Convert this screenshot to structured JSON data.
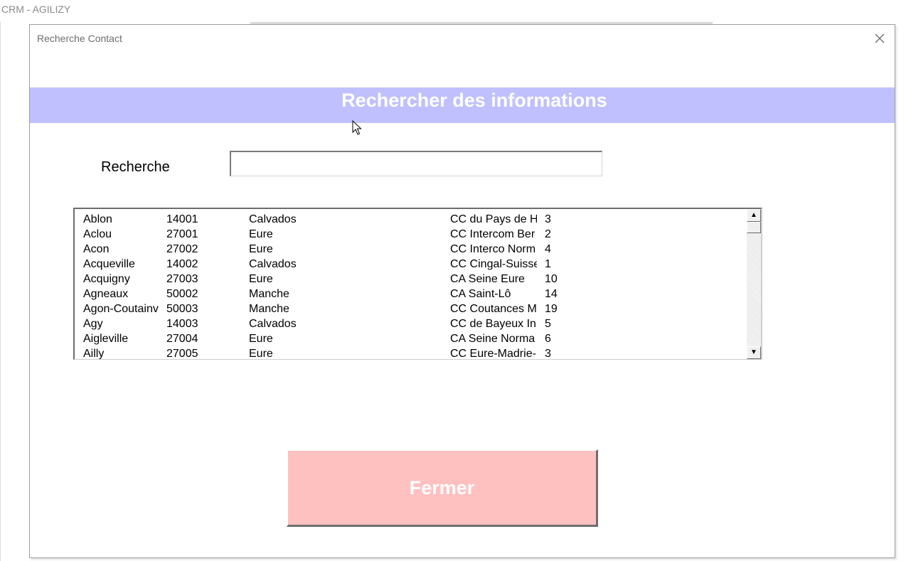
{
  "app": {
    "title": "CRM - AGILIZY"
  },
  "dialog": {
    "title": "Recherche Contact",
    "close_symbol": "close-icon",
    "banner_title": "Rechercher des informations",
    "banner_color": "#C0C0FF",
    "search": {
      "label": "Recherche",
      "value": "",
      "placeholder": ""
    },
    "list": {
      "rows": [
        [
          "Ablon",
          "14001",
          "Calvados",
          "CC du Pays de H",
          "3"
        ],
        [
          "Aclou",
          "27001",
          "Eure",
          "CC Intercom Ber",
          "2"
        ],
        [
          "Acon",
          "27002",
          "Eure",
          "CC Interco Norm",
          "4"
        ],
        [
          "Acqueville",
          "14002",
          "Calvados",
          "CC Cingal-Suisse",
          "1"
        ],
        [
          "Acquigny",
          "27003",
          "Eure",
          "CA Seine Eure",
          "10"
        ],
        [
          "Agneaux",
          "50002",
          "Manche",
          "CA Saint-Lô",
          "14"
        ],
        [
          "Agon-Coutainv",
          "50003",
          "Manche",
          "CC Coutances M",
          "19"
        ],
        [
          "Agy",
          "14003",
          "Calvados",
          "CC de Bayeux In",
          "5"
        ],
        [
          "Aigleville",
          "27004",
          "Eure",
          "CA Seine Norma",
          "6"
        ],
        [
          "Ailly",
          "27005",
          "Eure",
          "CC Eure-Madrie-",
          "3"
        ]
      ],
      "scroll_up_glyph": "▲",
      "scroll_down_glyph": "▼"
    },
    "close_button": {
      "label": "Fermer",
      "color": "#FFC0C0"
    }
  }
}
